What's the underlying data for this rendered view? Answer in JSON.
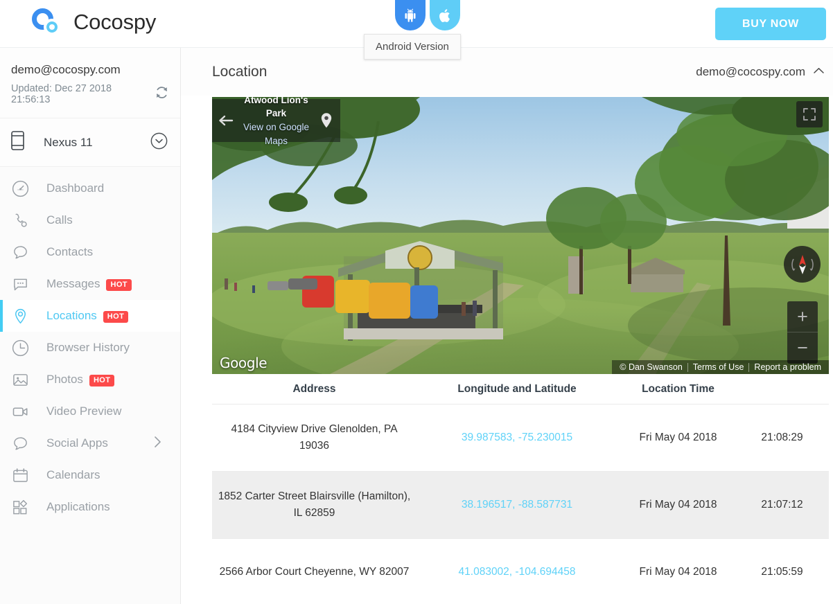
{
  "header": {
    "brand": "Cocospy",
    "logo_icon": "cocospy-logo-icon",
    "platform_tabs": [
      {
        "name": "android",
        "icon": "android-icon",
        "color": "#3b8ff0",
        "active": true
      },
      {
        "name": "ios",
        "icon": "apple-icon",
        "color": "#5fcdf7",
        "active": false
      }
    ],
    "tooltip": "Android Version",
    "buy_now_label": "BUY NOW",
    "buy_now_color": "#5fd2f8"
  },
  "sidebar": {
    "account_email": "demo@cocospy.com",
    "updated_label": "Updated: Dec 27 2018 21:56:13",
    "refresh_icon": "refresh-icon",
    "device_icon": "phone-icon",
    "device_name": "Nexus 11",
    "device_chevron_icon": "chevron-down-circle-icon",
    "items": [
      {
        "label": "Dashboard",
        "icon": "dashboard-icon",
        "badge": "",
        "active": false,
        "chevron": false
      },
      {
        "label": "Calls",
        "icon": "phone-call-icon",
        "badge": "",
        "active": false,
        "chevron": false
      },
      {
        "label": "Contacts",
        "icon": "contacts-bubble-icon",
        "badge": "",
        "active": false,
        "chevron": false
      },
      {
        "label": "Messages",
        "icon": "message-icon",
        "badge": "HOT",
        "active": false,
        "chevron": false
      },
      {
        "label": "Locations",
        "icon": "location-pin-icon",
        "badge": "HOT",
        "active": true,
        "chevron": false
      },
      {
        "label": "Browser History",
        "icon": "clock-icon",
        "badge": "",
        "active": false,
        "chevron": false
      },
      {
        "label": "Photos",
        "icon": "photo-icon",
        "badge": "HOT",
        "active": false,
        "chevron": false
      },
      {
        "label": "Video Preview",
        "icon": "video-camera-icon",
        "badge": "",
        "active": false,
        "chevron": false
      },
      {
        "label": "Social Apps",
        "icon": "chat-bubble-icon",
        "badge": "",
        "active": false,
        "chevron": true
      },
      {
        "label": "Calendars",
        "icon": "calendar-icon",
        "badge": "",
        "active": false,
        "chevron": false
      },
      {
        "label": "Applications",
        "icon": "apps-grid-icon",
        "badge": "",
        "active": false,
        "chevron": false
      }
    ],
    "accent_color": "#44cdf3",
    "badge_color": "#fc4a4a"
  },
  "main": {
    "page_title": "Location",
    "user_menu_email": "demo@cocospy.com",
    "user_menu_chevron_icon": "chevron-up-icon"
  },
  "streetview": {
    "place_name": "Atwood Lion's Park",
    "maps_link_label": "View on Google Maps",
    "back_icon": "arrow-left-icon",
    "pin_icon": "map-pin-icon",
    "fullscreen_icon": "fullscreen-icon",
    "compass_icon": "compass-icon",
    "zoom_in_label": "+",
    "zoom_out_label": "−",
    "watermark": "Google",
    "credit": "© Dan Swanson",
    "terms_label": "Terms of Use",
    "report_label": "Report a problem"
  },
  "table": {
    "columns": [
      "Address",
      "Longitude and Latitude",
      "Location Time",
      ""
    ],
    "rows": [
      {
        "address": "4184 Cityview Drive Glenolden, PA 19036",
        "coords": "39.987583, -75.230015",
        "date": "Fri May 04 2018",
        "time": "21:08:29"
      },
      {
        "address": "1852 Carter Street Blairsville (Hamilton), IL 62859",
        "coords": "38.196517, -88.587731",
        "date": "Fri May 04 2018",
        "time": "21:07:12"
      },
      {
        "address": "2566 Arbor Court Cheyenne, WY 82007",
        "coords": "41.083002, -104.694458",
        "date": "Fri May 04 2018",
        "time": "21:05:59"
      }
    ],
    "coord_color": "#5fd2f8"
  }
}
